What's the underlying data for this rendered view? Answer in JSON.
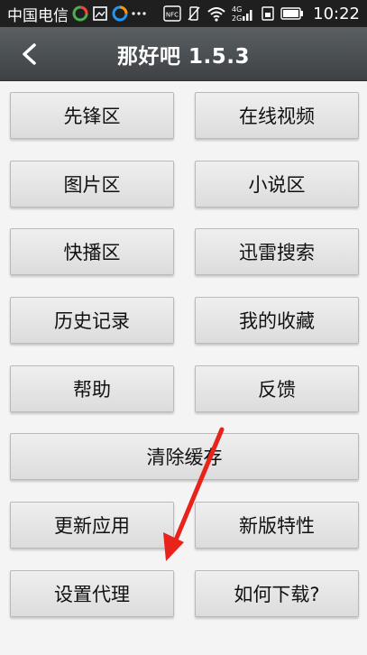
{
  "status_bar": {
    "carrier": "中国电信",
    "nfc": "NFC",
    "network": "4G",
    "network2": "2G",
    "time": "10:22"
  },
  "header": {
    "title": "那好吧 1.5.3"
  },
  "menu": {
    "xianfeng": "先锋区",
    "online_video": "在线视频",
    "pictures": "图片区",
    "novels": "小说区",
    "kuaibo": "快播区",
    "xunlei_search": "迅雷搜索",
    "history": "历史记录",
    "favorites": "我的收藏",
    "help": "帮助",
    "feedback": "反馈",
    "clear_cache": "清除缓存",
    "update_app": "更新应用",
    "new_features": "新版特性",
    "set_proxy": "设置代理",
    "how_to_download": "如何下载?"
  },
  "colors": {
    "annotation_arrow": "#e8231c",
    "title_bar": "#4a4e52"
  }
}
